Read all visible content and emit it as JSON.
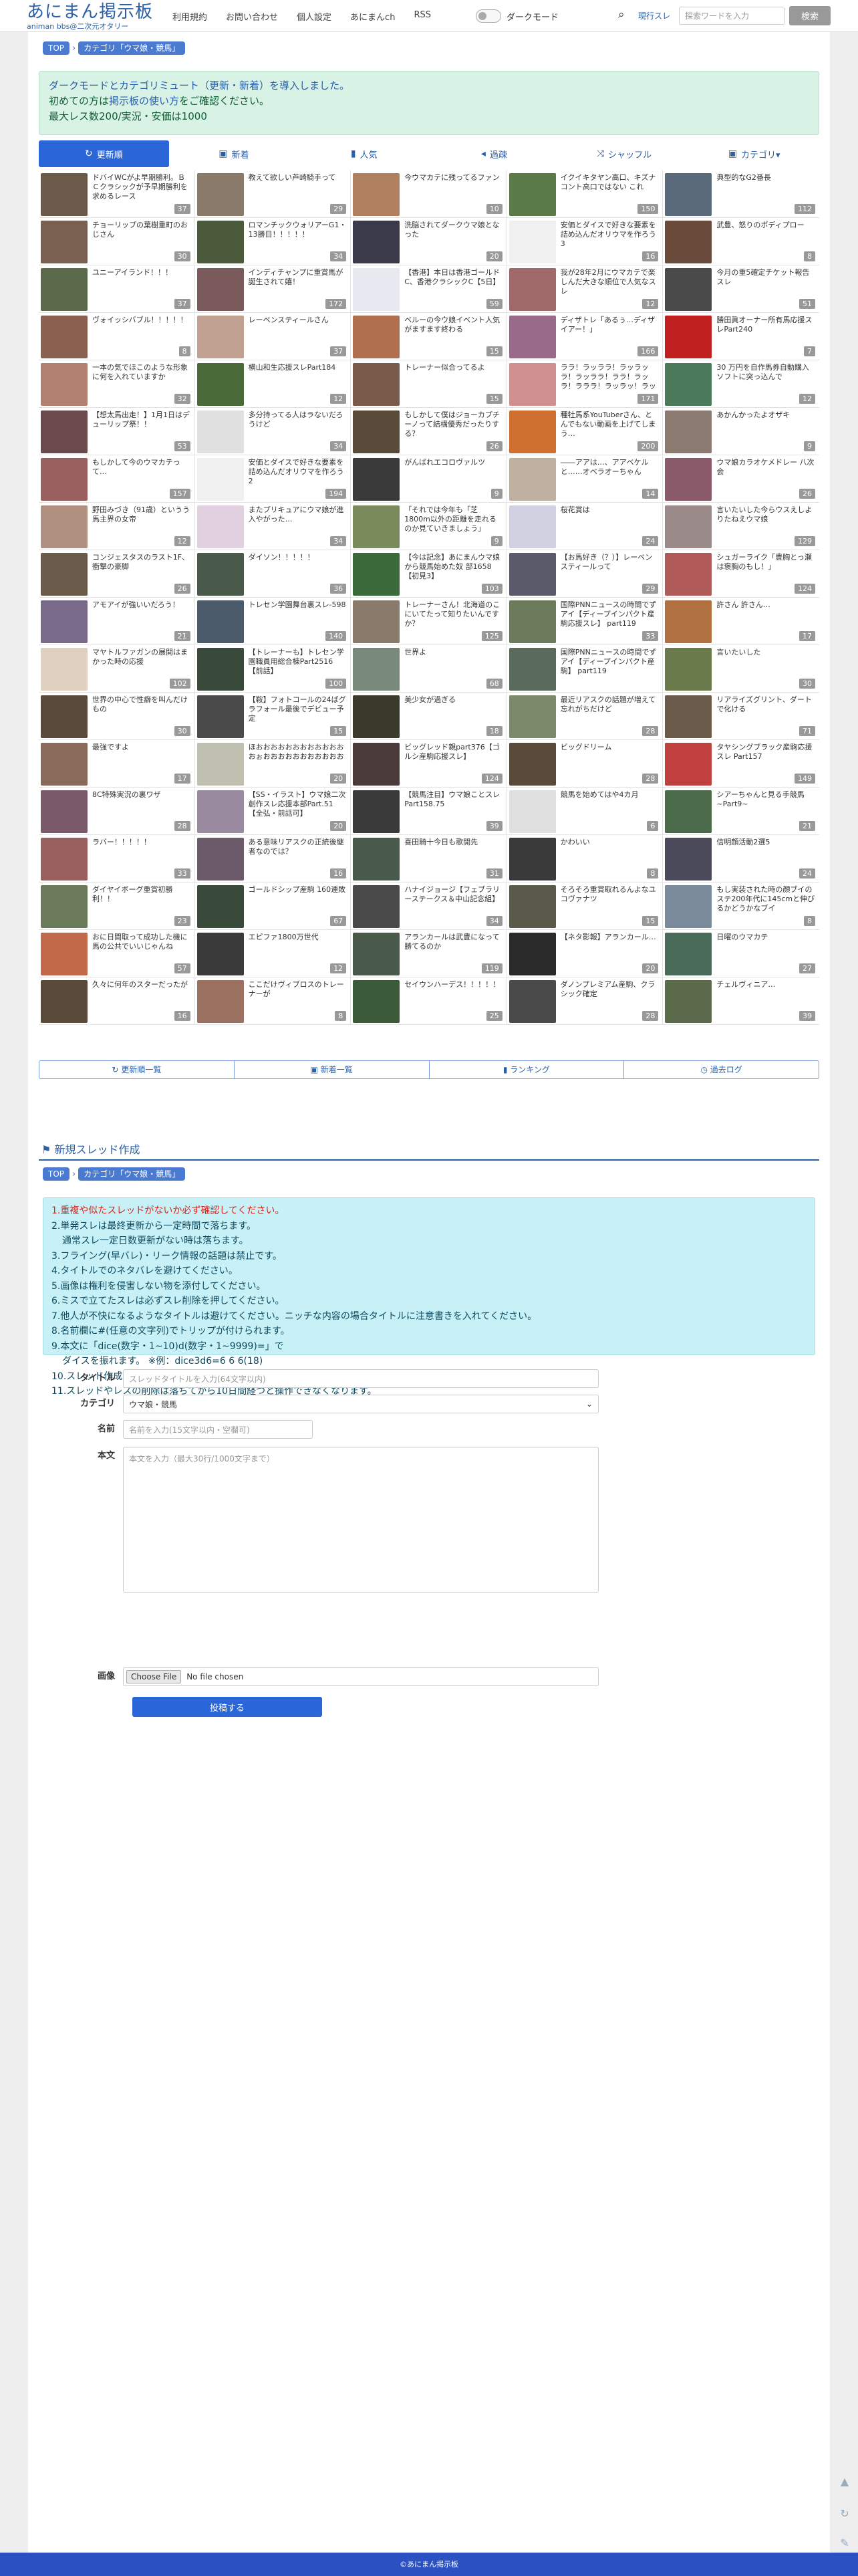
{
  "header": {
    "logo_title": "あにまん掲示板",
    "logo_sub": "animan bbs@二次元オタリー",
    "nav_links": [
      "利用規約",
      "お問い合わせ",
      "個人設定",
      "あにまんch",
      "RSS"
    ],
    "dark_mode_label": "ダークモード",
    "search_mode": "現行スレ",
    "search_placeholder": "探索ワードを入力",
    "search_button": "検索"
  },
  "breadcrumb": {
    "top": "TOP",
    "category": "カテゴリ「ウマ娘・競馬」"
  },
  "notice": {
    "line1": "ダークモードとカテゴリミュート（更新・新着）を導入しました。",
    "line2_pre": "初めての方は",
    "line2_link": "掲示板の使い方",
    "line2_post": "をご確認ください。",
    "line3": "最大レス数200/実況・安価は1000"
  },
  "tabs": [
    {
      "label": "更新順",
      "icon": "↻",
      "name": "tab-update-order"
    },
    {
      "label": "新着",
      "icon": "▣",
      "name": "tab-new"
    },
    {
      "label": "人気",
      "icon": "▮",
      "name": "tab-popular"
    },
    {
      "label": "過疎",
      "icon": "◂",
      "name": "tab-sparse"
    },
    {
      "label": "シャッフル",
      "icon": "⤨",
      "name": "tab-shuffle"
    },
    {
      "label": "カテゴリ▾",
      "icon": "▣",
      "name": "tab-category"
    }
  ],
  "threads": [
    {
      "title": "ドバイWCがよ早期勝利。ＢＣクラシックが予早期勝利を求めるレース",
      "count": "37",
      "color": "#6b5a4a"
    },
    {
      "title": "教えて欲しい芦崎騎手って",
      "count": "29",
      "color": "#8a7a6a"
    },
    {
      "title": "今ウマカテに残ってるファン",
      "count": "10",
      "color": "#b08060"
    },
    {
      "title": "イクイキタヤン高口、キズナコント高口ではない これ",
      "count": "150",
      "color": "#5a7a4a"
    },
    {
      "title": "典型的なG2番長",
      "count": "112",
      "color": "#5a6a7a"
    },
    {
      "title": "チョーリップの葉樹重町のおじさん",
      "count": "30",
      "color": "#7a6050"
    },
    {
      "title": "ロマンチックウォリアーG1・13勝目！！！！！",
      "count": "34",
      "color": "#4a5a3a"
    },
    {
      "title": "洗脳されてダークウマ娘となった",
      "count": "20",
      "color": "#3a3a4a"
    },
    {
      "title": "安価とダイスで好きな要素を詰め込んだオリウマを作ろう 3",
      "count": "16",
      "color": "#f0f0f0"
    },
    {
      "title": "武豊、怒りのポディプロー",
      "count": "8",
      "color": "#6a4a3a"
    },
    {
      "title": "ユニーアイランド！！！",
      "count": "37",
      "color": "#5a6a4a"
    },
    {
      "title": "インディチャンプに重賞馬が誕生されて嬉！",
      "count": "172",
      "color": "#7a5a5a"
    },
    {
      "title": "【香港】本日は香港ゴールドC、香港クラシックC【5日】",
      "count": "59",
      "color": "#e8e8f0"
    },
    {
      "title": "我が28年2月にウマカテで楽しんだ大きな順位で人気なスレ",
      "count": "12",
      "color": "#a06a6a"
    },
    {
      "title": "今月の重5確定チケット報告スレ",
      "count": "51",
      "color": "#4a4a4a"
    },
    {
      "title": "ヴォイッシバブル！！！！！",
      "count": "8",
      "color": "#8a6050"
    },
    {
      "title": "レーベンスティールさん",
      "count": "37",
      "color": "#c0a090"
    },
    {
      "title": "ベルーの今ウ娘イベント人気がますます終わる",
      "count": "15",
      "color": "#b07050"
    },
    {
      "title": "ディザトレ「あるぅ…ディザイアー！」",
      "count": "166",
      "color": "#9a6a8a"
    },
    {
      "title": "勝田眞オーナー所有馬応援スレPart240",
      "count": "7",
      "color": "#c02020"
    },
    {
      "title": "一本の気でほこのような形象に何を入れていますか",
      "count": "32",
      "color": "#b08070"
    },
    {
      "title": "横山和生応援スレPart184",
      "count": "12",
      "color": "#4a6a3a"
    },
    {
      "title": "トレーナー似合ってるよ",
      "count": "15",
      "color": "#7a5a4a"
    },
    {
      "title": "ララ！ラッララ！ラッラッラ！ラッララ！ララ！ラッラ！ラララ！ラッラッ！ラッラッラ！",
      "count": "171",
      "color": "#d09090"
    },
    {
      "title": "30 万円を自作馬券自動購入ソフトに突っ込んで",
      "count": "12",
      "color": "#4a7a5a"
    },
    {
      "title": "【想太馬出走！】1月1日はデューリップ祭！！",
      "count": "53",
      "color": "#6a4a4a"
    },
    {
      "title": "多分持ってる人はラないだろうけど",
      "count": "34",
      "color": "#e0e0e0"
    },
    {
      "title": "もしかして僕はジョーカプチーノって結構優秀だったりする？",
      "count": "26",
      "color": "#5a4a3a"
    },
    {
      "title": "種牡馬系YouTuberさん、とんでもない動画を上げてしまう…",
      "count": "200",
      "color": "#d07030"
    },
    {
      "title": "あかんかったよオザキ",
      "count": "9",
      "color": "#8a7a70"
    },
    {
      "title": "もしかして今のウマカテって…",
      "count": "157",
      "color": "#9a6060"
    },
    {
      "title": "安価とダイスで好きな要素を詰め込んだオリウマを作ろう 2",
      "count": "194",
      "color": "#f0f0f0"
    },
    {
      "title": "がんばれエコロヴァルツ",
      "count": "9",
      "color": "#3a3a3a"
    },
    {
      "title": "――アアは…、アアベケルと……オベラオーちゃん",
      "count": "14",
      "color": "#c0b0a0"
    },
    {
      "title": "ウマ娘カラオケメドレー 八次会",
      "count": "26",
      "color": "#8a5a6a"
    },
    {
      "title": "野田みづき（91歳）というう馬主界の女帝",
      "count": "12",
      "color": "#b09080"
    },
    {
      "title": "またプリキュアにウマ娘が進入やがった…",
      "count": "34",
      "color": "#e0d0e0"
    },
    {
      "title": "「それでは今年も「芝1800m以外の距離を走れるのか見ていきましょう」",
      "count": "9",
      "color": "#7a8a5a"
    },
    {
      "title": "桜花賞は",
      "count": "24",
      "color": "#d0d0e0"
    },
    {
      "title": "言いたいした今らウスえしよりたねえウマ娘",
      "count": "129",
      "color": "#9a8a8a"
    },
    {
      "title": "コンジェスタスのラスト1F、衝撃の豪脚",
      "count": "26",
      "color": "#6a5a4a"
    },
    {
      "title": "ダイソン！！！！！",
      "count": "36",
      "color": "#4a5a4a"
    },
    {
      "title": "【今は記念】あにまんウマ娘から競馬始めた奴 部1658【初見3】",
      "count": "103",
      "color": "#3a6a3a"
    },
    {
      "title": "【お馬好き（？）】レーベンスティールって",
      "count": "29",
      "color": "#5a5a6a"
    },
    {
      "title": "シュガーライク「豊胸とっ瀬は褒胸のもし！」",
      "count": "124",
      "color": "#b05a5a"
    },
    {
      "title": "アモアイが強いいだろう！",
      "count": "21",
      "color": "#7a6a8a"
    },
    {
      "title": "トレセン学園舞台裏スレ-598",
      "count": "140",
      "color": "#4a5a6a"
    },
    {
      "title": "トレーナーさん！北海道のこにいてたって知りたいんですか？",
      "count": "125",
      "color": "#8a7a6a"
    },
    {
      "title": "国際PNNニュースの時間でずアイ【ディープインパクト産駒応援スレ】 part119",
      "count": "33",
      "color": "#6a7a5a"
    },
    {
      "title": "許さん 許さん…",
      "count": "17",
      "color": "#b07040"
    },
    {
      "title": "マヤトルファガンの展開はまかった時の応援",
      "count": "102",
      "color": "#e0d0c0"
    },
    {
      "title": "【トレーナーも】トレセン学園職員用総合棟Part2516【前話】",
      "count": "100",
      "color": "#3a4a3a"
    },
    {
      "title": "世界よ",
      "count": "68",
      "color": "#7a8a7a"
    },
    {
      "title": "国際PNNニュースの時間でずアイ【ディープインパクト産駒】 part119",
      "count": "",
      "color": "#5a6a5a"
    },
    {
      "title": "言いたいした",
      "count": "30",
      "color": "#6a7a4a"
    },
    {
      "title": "世界の中心で性癖を叫んだけもの",
      "count": "30",
      "color": "#5a4a3a"
    },
    {
      "title": "【鞍】フォトコールの24ばグラフォール最後でデビュー予定",
      "count": "15",
      "color": "#4a4a4a"
    },
    {
      "title": "美少女が過ぎる",
      "count": "18",
      "color": "#3a3a2a"
    },
    {
      "title": "最近リアスクの話題が増えて忘れがちだけど",
      "count": "28",
      "color": "#7a8a6a"
    },
    {
      "title": "リアライズグリント、ダートで化ける",
      "count": "71",
      "color": "#6a5a4a"
    },
    {
      "title": "最強ですよ",
      "count": "17",
      "color": "#8a6a5a"
    },
    {
      "title": "ほおおおおおおおおおおおおおぉおおおおおおおおおおお",
      "count": "20",
      "color": "#c0c0b0"
    },
    {
      "title": "ビッグレッド親part376【ゴルシ産駒応援スレ】",
      "count": "124",
      "color": "#4a3a3a"
    },
    {
      "title": "ビッグドリーム",
      "count": "28",
      "color": "#5a4a3a"
    },
    {
      "title": "タヤシングブラック産駒応援スレ Part157",
      "count": "149",
      "color": "#c04040"
    },
    {
      "title": "8C特殊実況の裏ワザ",
      "count": "28",
      "color": "#7a5a6a"
    },
    {
      "title": "【SS・イラスト】ウマ娘二次創作スレ応援本部Part.51【全弘・前話可】",
      "count": "20",
      "color": "#9a8aa0"
    },
    {
      "title": "【競馬注目】ウマ娘ことスレPart158.75",
      "count": "39",
      "color": "#3a3a3a"
    },
    {
      "title": "競馬を始めてはや4カ月",
      "count": "6",
      "color": "#e0e0e0"
    },
    {
      "title": "シアーちゃんと見る手競馬~Part9~",
      "count": "21",
      "color": "#4a6a4a"
    },
    {
      "title": "ラバー！！！！！",
      "count": "33",
      "color": "#9a6060"
    },
    {
      "title": "ある意味リアスクの正統後継者なのでは？",
      "count": "16",
      "color": "#6a5a6a"
    },
    {
      "title": "喜田騎十今日も歌開先",
      "count": "31",
      "color": "#4a5a4a"
    },
    {
      "title": "かわいい",
      "count": "8",
      "color": "#3a3a3a"
    },
    {
      "title": "信明顔活動2選5",
      "count": "24",
      "color": "#4a4a5a"
    },
    {
      "title": "ダイヤイボーグ重賞初勝利！！",
      "count": "23",
      "color": "#6a7a5a"
    },
    {
      "title": "ゴールドシップ産駒 160連敗",
      "count": "67",
      "color": "#3a4a3a"
    },
    {
      "title": "ハナイジョージ【フェブラリーステークス＆中山記念組】",
      "count": "34",
      "color": "#4a4a4a"
    },
    {
      "title": "そろそろ重賞取れるんよなユコヴァナツ",
      "count": "15",
      "color": "#5a5a4a"
    },
    {
      "title": "もし実装された時の顔ブイのステ200年代に145cmと伸びるかどうかなブイ",
      "count": "8",
      "color": "#7a8a9a"
    },
    {
      "title": "おに日間取って成功した機に馬の公共でいいじゃんね",
      "count": "57",
      "color": "#c06a4a"
    },
    {
      "title": "エピファ1800万世代",
      "count": "12",
      "color": "#3a3a3a"
    },
    {
      "title": "アランカールは武豊になって勝てるのか",
      "count": "119",
      "color": "#4a5a4a"
    },
    {
      "title": "【ネタ影報】アランカール…",
      "count": "20",
      "color": "#2a2a2a"
    },
    {
      "title": "日曜のウマカテ",
      "count": "27",
      "color": "#4a6a5a"
    },
    {
      "title": "久々に何年のスターだったが",
      "count": "16",
      "color": "#5a4a3a"
    },
    {
      "title": "ここだけヴィブロスのトレーナーが",
      "count": "8",
      "color": "#9a7060"
    },
    {
      "title": "セイウンハーデス！！！！！",
      "count": "25",
      "color": "#3a5a3a"
    },
    {
      "title": "ダノンプレミアム産駒、クラシック確定",
      "count": "28",
      "color": "#4a4a4a"
    },
    {
      "title": "チェルヴィニア…",
      "count": "39",
      "color": "#5a6a4a"
    }
  ],
  "bottom_nav": [
    {
      "label": "更新順一覧",
      "icon": "↻"
    },
    {
      "label": "新着一覧",
      "icon": "▣"
    },
    {
      "label": "ランキング",
      "icon": "▮"
    },
    {
      "label": "過去ログ",
      "icon": "◷"
    }
  ],
  "new_thread": {
    "heading": "新規スレッド作成",
    "rules": [
      "1.重複や似たスレッドがないか必ず確認してください。",
      "2.単発スレは最終更新から一定時間で落ちます。",
      "通常スレ一定日数更新がない時は落ちます。",
      "3.フライング(早バレ)・リーク情報の話題は禁止です。",
      "4.タイトルでのネタバレを避けてください。",
      "5.画像は権利を侵害しない物を添付してください。",
      "6.ミスで立てたスレは必ずスレ削除を押してください。",
      "7.他人が不快になるようなタイトルは避けてください。ニッチな内容の場合タイトルに注意書きを入れてください。",
      "8.名前欄に#(任意の文字列)でトリップが付けられます。",
      "9.本文に「dice(数字・1~10)d(数字・1~9999)=」で",
      "ダイスを振れます。 ※例：dice3d6=6 6 6(18)",
      "10.スレッド作成は承認制とする場合があります。",
      "11.スレッドやレスの削除は落ちてから10日間経つと操作できなくなります。"
    ],
    "title_label": "タイトル",
    "title_placeholder": "スレッドタイトルを入力(64文字以内)",
    "category_label": "カテゴリ",
    "category_value": "ウマ娘・競馬",
    "name_label": "名前",
    "name_placeholder": "名前を入力(15文字以内・空欄可)",
    "body_label": "本文",
    "body_placeholder": "本文を入力（最大30行/1000文字まで）",
    "image_label": "画像",
    "file_button": "Choose File",
    "file_status": "No file chosen",
    "submit": "投稿する"
  },
  "footer": "©あにまん掲示板",
  "colors": {
    "accent": "#2b66d9",
    "notice_bg": "#d9f2e6",
    "rules_bg": "#c7f1f7",
    "footer_bg": "#2b50c2"
  }
}
